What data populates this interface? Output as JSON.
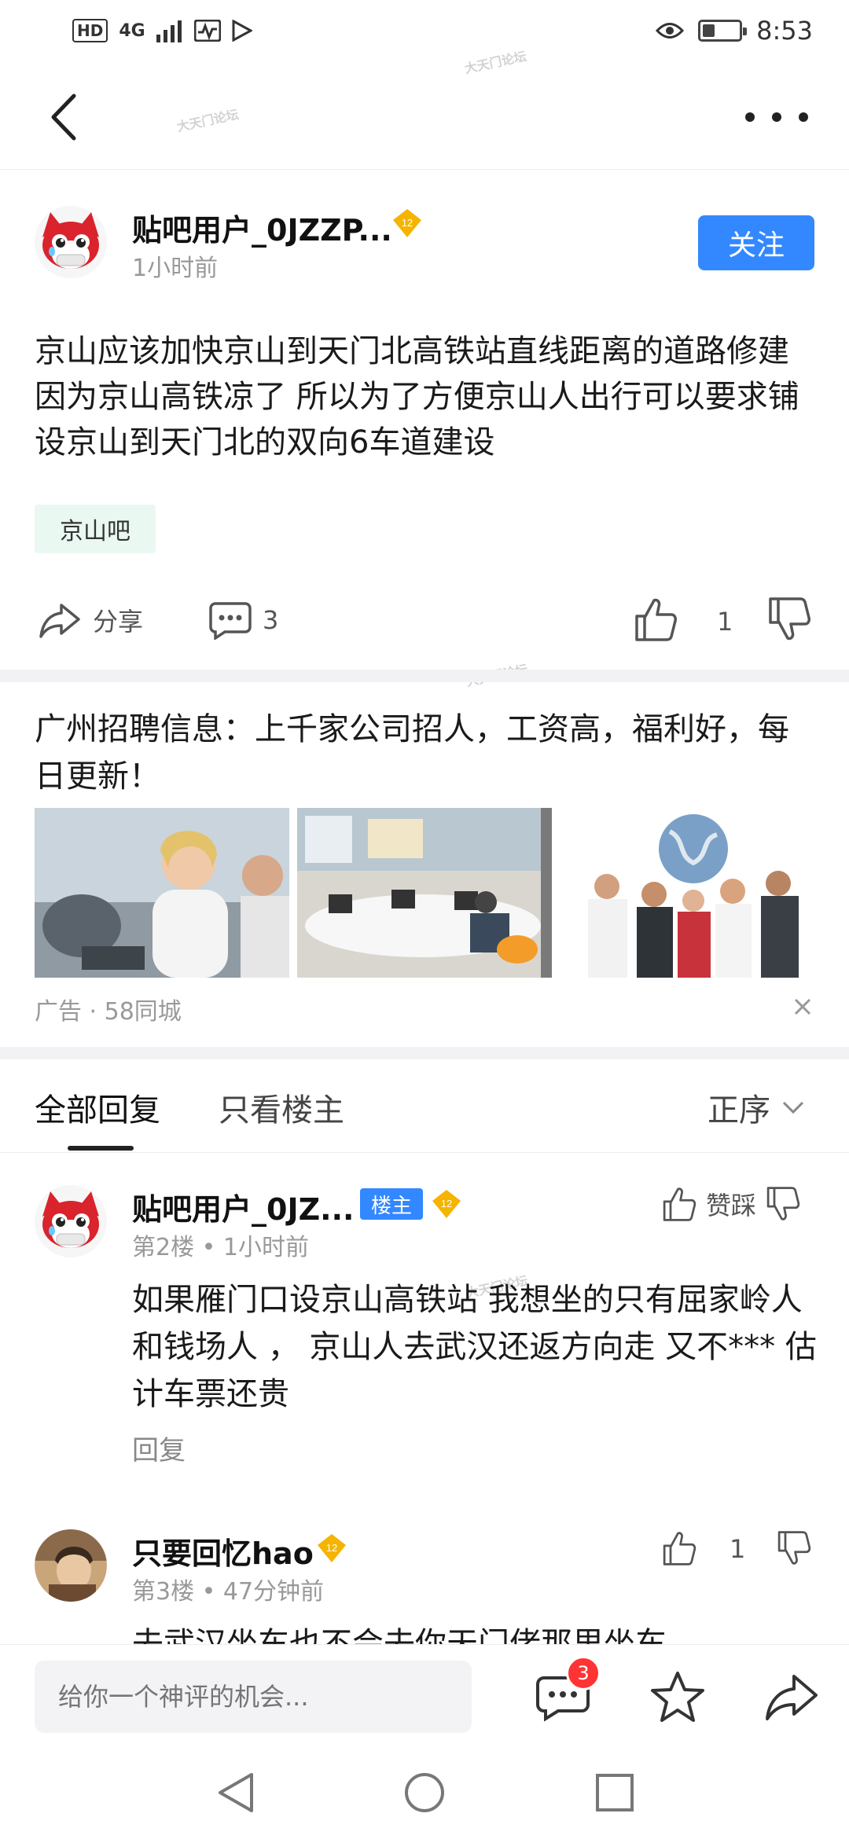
{
  "status_bar": {
    "network": "HD",
    "signal": "4G",
    "time": "8:53",
    "battery_level": 0.35
  },
  "nav": {
    "back_icon": "chevron-left-icon",
    "more_icon": "more-dots-icon"
  },
  "watermark": "大天门论坛",
  "post": {
    "username": "贴吧用户_0JZZP...",
    "level": "12",
    "time": "1小时前",
    "follow_label": "关注",
    "content": "京山应该加快京山到天门北高铁站直线距离的道路修建 因为京山高铁凉了 所以为了方便京山人出行可以要求铺设京山到天门北的双向6车道建设",
    "forum_tag": "京山吧",
    "share_label": "分享",
    "comment_count": "3",
    "like_count": "1"
  },
  "ad": {
    "title": "广州招聘信息：上千家公司招人，工资高，福利好，每日更新！",
    "label": "广告 · 58同城"
  },
  "tabs": {
    "all_replies": "全部回复",
    "op_only": "只看楼主",
    "sort": "正序"
  },
  "replies": [
    {
      "username": "贴吧用户_0JZ...",
      "op_badge": "楼主",
      "level": "12",
      "meta": "第2楼 • 1小时前",
      "action_label": "赞踩",
      "content": "如果雁门口设京山高铁站 我想坐的只有屈家岭人和钱场人 ， 京山人去武汉还返方向走 又不*** 估计车票还贵",
      "reply_label": "回复"
    },
    {
      "username": "只要回忆hao",
      "level": "12",
      "meta": "第3楼 • 47分钟前",
      "like_count": "1",
      "content": "去武汉坐车也不会去你天门佬那里坐车"
    }
  ],
  "bottom_bar": {
    "comment_placeholder": "给你一个神评的机会...",
    "comment_badge": "3"
  },
  "colors": {
    "accent": "#3388ff",
    "badge_red": "#ff3333",
    "tag_bg": "#eaf8f2",
    "level_gold": "#f5b400"
  }
}
